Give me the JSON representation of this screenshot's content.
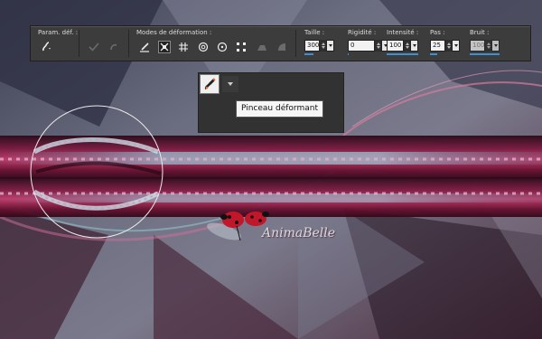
{
  "toolbar": {
    "presets_label": "Param. déf. :",
    "modes_label": "Modes de déformation :",
    "size": {
      "label": "Taille :",
      "value": "300",
      "level": 0.3
    },
    "stiffness": {
      "label": "Rigidité :",
      "value": "0",
      "level": 0.0
    },
    "intensity": {
      "label": "Intensité :",
      "value": "100",
      "level": 1.0
    },
    "step": {
      "label": "Pas :",
      "value": "25",
      "level": 0.25
    },
    "noise": {
      "label": "Bruit :",
      "value": "100",
      "level": 1.0
    },
    "modes": [
      "push-icon",
      "expand-icon",
      "contract-icon",
      "twirl-right-icon",
      "twirl-left-icon",
      "noise-icon",
      "iron-icon",
      "unwarp-icon"
    ]
  },
  "tool": {
    "icon": "warp-brush-icon",
    "tooltip": "Pinceau déformant"
  },
  "canvas": {
    "watermark": "AnimaBelle",
    "accent": "#8a1a45",
    "brush_circle": "#e8e8e8"
  }
}
